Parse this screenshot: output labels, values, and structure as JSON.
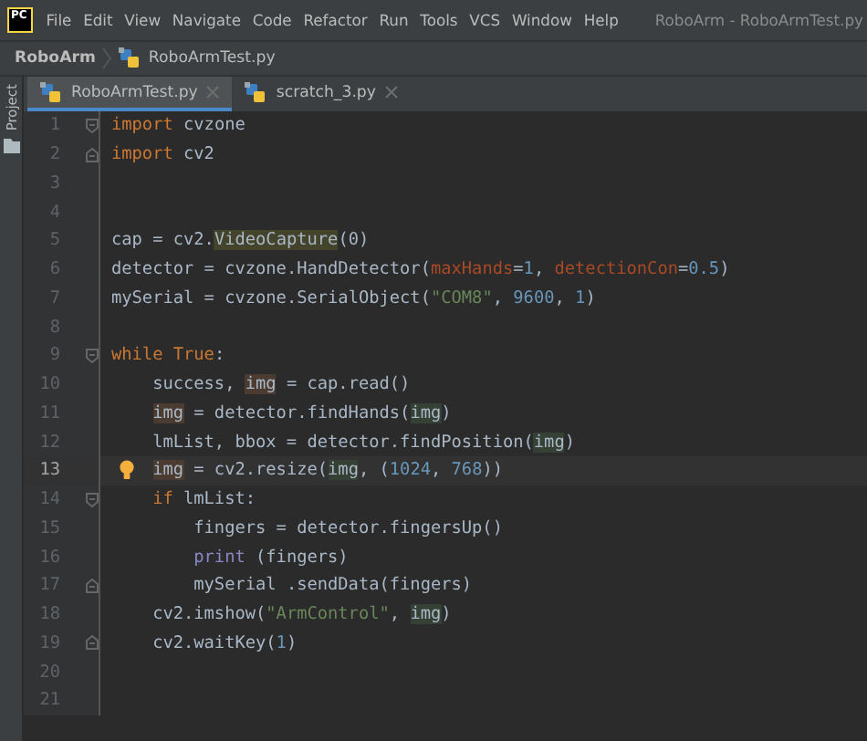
{
  "logo_text": "PC",
  "menu": [
    "File",
    "Edit",
    "View",
    "Navigate",
    "Code",
    "Refactor",
    "Run",
    "Tools",
    "VCS",
    "Window",
    "Help"
  ],
  "window": {
    "title": "RoboArm - RoboArmTest.py"
  },
  "breadcrumb": {
    "project": "RoboArm",
    "file": "RoboArmTest.py"
  },
  "side_panel": {
    "label": "Project"
  },
  "tabs": [
    {
      "label": "RoboArmTest.py",
      "selected": true
    },
    {
      "label": "scratch_3.py",
      "selected": false
    }
  ],
  "lines": [
    {
      "n": "1",
      "fold_open": true,
      "current": false,
      "tokens": [
        {
          "text": "import",
          "kind": "kw"
        },
        {
          "text": " cvzone",
          "kind": "plain"
        }
      ]
    },
    {
      "n": "2",
      "fold_close": true,
      "current": false,
      "tokens": [
        {
          "text": "import",
          "kind": "kw"
        },
        {
          "text": " cv2",
          "kind": "plain"
        }
      ]
    },
    {
      "n": "3",
      "current": false
    },
    {
      "n": "4",
      "current": false
    },
    {
      "n": "5",
      "current": false,
      "tokens": [
        {
          "text": "cap = cv2.",
          "kind": "plain"
        },
        {
          "text": "VideoCapture",
          "kind": "search"
        },
        {
          "text": "(0)",
          "kind": "plain"
        }
      ]
    },
    {
      "n": "6",
      "current": false,
      "tokens": [
        {
          "text": "detector = cvzone.HandDetector(",
          "kind": "plain"
        },
        {
          "text": "maxHands",
          "kind": "param"
        },
        {
          "text": "=",
          "kind": "plain"
        },
        {
          "text": "1",
          "kind": "num"
        },
        {
          "text": ", ",
          "kind": "plain"
        },
        {
          "text": "detectionCon",
          "kind": "param"
        },
        {
          "text": "=",
          "kind": "plain"
        },
        {
          "text": "0.5",
          "kind": "num"
        },
        {
          "text": ")",
          "kind": "plain"
        }
      ]
    },
    {
      "n": "7",
      "current": false,
      "tokens": [
        {
          "text": "mySerial = cvzone.SerialObject(",
          "kind": "plain"
        },
        {
          "text": "\"COM8\"",
          "kind": "str"
        },
        {
          "text": ", ",
          "kind": "plain"
        },
        {
          "text": "9600",
          "kind": "num"
        },
        {
          "text": ", ",
          "kind": "plain"
        },
        {
          "text": "1",
          "kind": "num"
        },
        {
          "text": ")",
          "kind": "plain"
        }
      ]
    },
    {
      "n": "8",
      "current": false
    },
    {
      "n": "9",
      "fold_open": true,
      "current": false,
      "tokens": [
        {
          "text": "while",
          "kind": "kw"
        },
        {
          "text": " True",
          "kind": "kw"
        },
        {
          "text": ":",
          "kind": "plain"
        }
      ],
      "children": [
        {
          "n": "10",
          "current": false,
          "tokens": [
            {
              "text": "success, ",
              "kind": "plain"
            },
            {
              "text": "img",
              "kind": "write"
            },
            {
              "text": " = cap.read()",
              "kind": "plain"
            }
          ]
        },
        {
          "n": "11",
          "current": false,
          "tokens": [
            {
              "text": "img",
              "kind": "write"
            },
            {
              "text": " = detector.findHands(",
              "kind": "plain"
            },
            {
              "text": "img",
              "kind": "read"
            },
            {
              "text": ")",
              "kind": "plain"
            }
          ]
        },
        {
          "n": "12",
          "current": false,
          "tokens": [
            {
              "text": "lmList, bbox = detector.findPosition(",
              "kind": "plain"
            },
            {
              "text": "img",
              "kind": "read"
            },
            {
              "text": ")",
              "kind": "plain"
            }
          ]
        },
        {
          "n": "13",
          "current": true,
          "bulb": true,
          "tokens": [
            {
              "text": "img",
              "kind": "write"
            },
            {
              "text": " = cv2.resize(",
              "kind": "plain"
            },
            {
              "text": "img",
              "kind": "read"
            },
            {
              "text": ", (",
              "kind": "plain"
            },
            {
              "text": "1024",
              "kind": "num"
            },
            {
              "text": ", ",
              "kind": "plain"
            },
            {
              "text": "768",
              "kind": "num"
            },
            {
              "text": "))",
              "kind": "plain"
            }
          ]
        },
        {
          "n": "14",
          "fold_open": true,
          "current": false,
          "tokens": [
            {
              "text": "if",
              "kind": "kw"
            },
            {
              "text": " lmList:",
              "kind": "plain"
            }
          ],
          "children": [
            {
              "n": "15",
              "current": false,
              "tokens": [
                {
                  "text": "fingers = detector.fingersUp()",
                  "kind": "plain"
                }
              ]
            },
            {
              "n": "16",
              "current": false,
              "tokens": [
                {
                  "text": "print",
                  "kind": "builtin"
                },
                {
                  "text": " (fingers)",
                  "kind": "plain"
                }
              ]
            },
            {
              "n": "17",
              "fold_close": true,
              "current": false,
              "tokens": [
                {
                  "text": "mySerial .sendData(fingers)",
                  "kind": "plain"
                }
              ]
            }
          ]
        },
        {
          "n": "18",
          "current": false,
          "tokens": [
            {
              "text": "cv2.imshow(",
              "kind": "plain"
            },
            {
              "text": "\"ArmControl\"",
              "kind": "str"
            },
            {
              "text": ", ",
              "kind": "plain"
            },
            {
              "text": "img",
              "kind": "read"
            },
            {
              "text": ")",
              "kind": "plain"
            }
          ]
        },
        {
          "n": "19",
          "fold_close": true,
          "current": false,
          "tokens": [
            {
              "text": "cv2.waitKey(",
              "kind": "plain"
            },
            {
              "text": "1",
              "kind": "num"
            },
            {
              "text": ")",
              "kind": "plain"
            }
          ]
        }
      ]
    },
    {
      "n": "20",
      "current": false
    },
    {
      "n": "21",
      "current": false
    }
  ]
}
